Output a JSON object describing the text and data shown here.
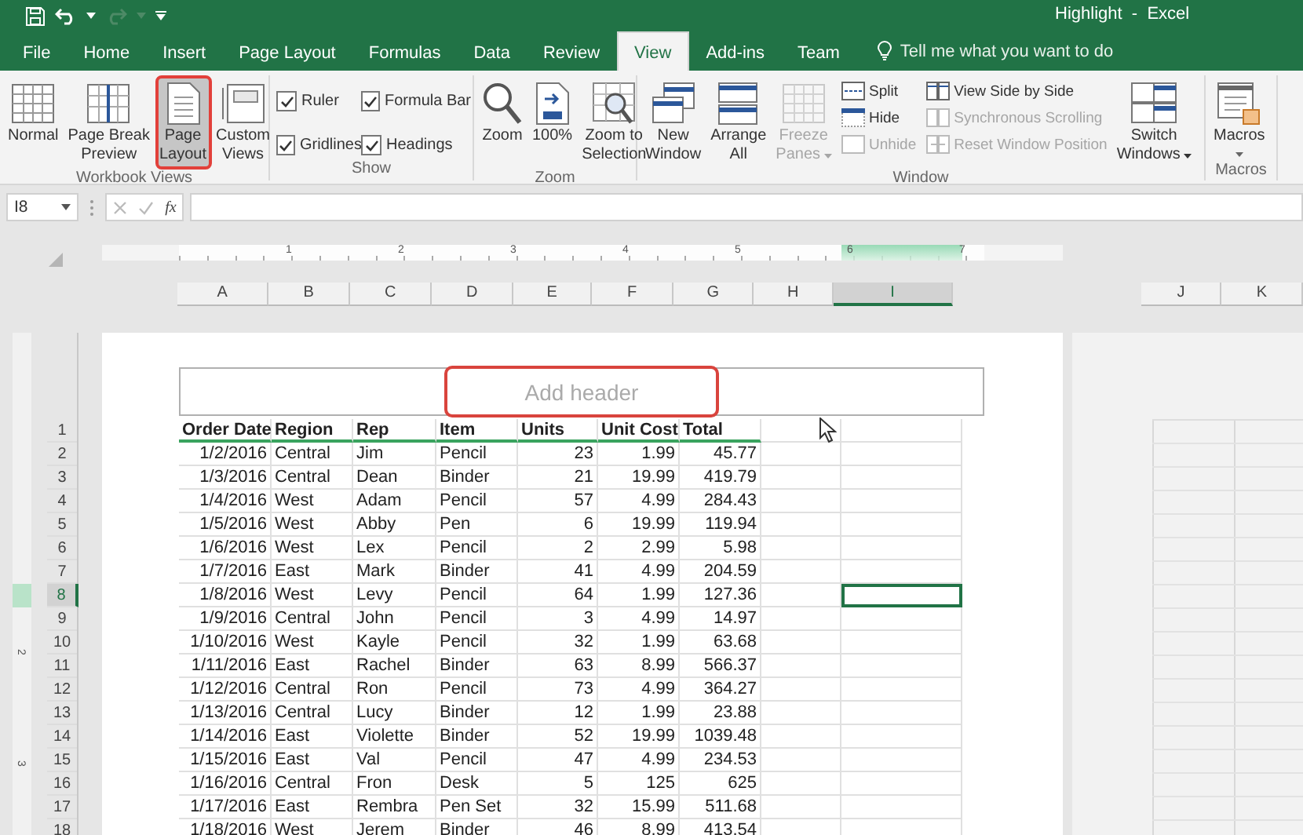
{
  "title_bar": {
    "title": "Highlight  -  Excel"
  },
  "tabs": [
    {
      "label": "File",
      "selected": false
    },
    {
      "label": "Home",
      "selected": false
    },
    {
      "label": "Insert",
      "selected": false
    },
    {
      "label": "Page Layout",
      "selected": false
    },
    {
      "label": "Formulas",
      "selected": false
    },
    {
      "label": "Data",
      "selected": false
    },
    {
      "label": "Review",
      "selected": false
    },
    {
      "label": "View",
      "selected": true
    },
    {
      "label": "Add-ins",
      "selected": false
    },
    {
      "label": "Team",
      "selected": false
    }
  ],
  "tell_me": {
    "placeholder": "Tell me what you want to do"
  },
  "ribbon": {
    "groups": [
      {
        "label": "Workbook Views",
        "items": [
          {
            "kind": "large",
            "lines": [
              "Normal"
            ],
            "selected": false
          },
          {
            "kind": "large",
            "lines": [
              "Page Break",
              "Preview"
            ],
            "selected": false
          },
          {
            "kind": "large",
            "lines": [
              "Page",
              "Layout"
            ],
            "selected": true
          },
          {
            "kind": "large",
            "lines": [
              "Custom",
              "Views"
            ],
            "selected": false
          }
        ]
      },
      {
        "label": "Show",
        "items": [
          {
            "kind": "check",
            "label": "Ruler",
            "checked": true
          },
          {
            "kind": "check",
            "label": "Formula Bar",
            "checked": true
          },
          {
            "kind": "check",
            "label": "Gridlines",
            "checked": true
          },
          {
            "kind": "check",
            "label": "Headings",
            "checked": true
          }
        ]
      },
      {
        "label": "Zoom",
        "items": [
          {
            "kind": "large",
            "lines": [
              "Zoom"
            ]
          },
          {
            "kind": "large",
            "lines": [
              "100%"
            ]
          },
          {
            "kind": "large",
            "lines": [
              "Zoom to",
              "Selection"
            ]
          }
        ]
      },
      {
        "label": "Window",
        "items": [
          {
            "kind": "large",
            "lines": [
              "New",
              "Window"
            ],
            "disabled": false
          },
          {
            "kind": "large",
            "lines": [
              "Arrange",
              "All"
            ],
            "disabled": false
          },
          {
            "kind": "large",
            "lines": [
              "Freeze",
              "Panes"
            ],
            "disabled": true,
            "dropdown": true
          },
          {
            "kind": "stack",
            "items": [
              {
                "label": "Split",
                "disabled": false
              },
              {
                "label": "Hide",
                "disabled": false
              },
              {
                "label": "Unhide",
                "disabled": true
              }
            ]
          },
          {
            "kind": "stack",
            "items": [
              {
                "label": "View Side by Side",
                "disabled": false
              },
              {
                "label": "Synchronous Scrolling",
                "disabled": true
              },
              {
                "label": "Reset Window Position",
                "disabled": true
              }
            ]
          },
          {
            "kind": "large",
            "lines": [
              "Switch",
              "Windows"
            ],
            "disabled": false,
            "dropdown": true
          }
        ]
      },
      {
        "label": "Macros",
        "items": [
          {
            "kind": "large",
            "lines": [
              "Macros"
            ],
            "dropdown": true
          }
        ]
      }
    ]
  },
  "formula_bar": {
    "name_box": "I8",
    "function_label": "fx"
  },
  "ruler": {
    "marks": [
      "1",
      "2",
      "3",
      "4",
      "5",
      "6",
      "7"
    ]
  },
  "vertical_ruler": {
    "marks": [
      "2",
      "3"
    ]
  },
  "header": {
    "placeholder": "Add header",
    "highlighted": true
  },
  "sheet": {
    "columns": [
      {
        "letter": "A",
        "selected": false
      },
      {
        "letter": "B",
        "selected": false
      },
      {
        "letter": "C",
        "selected": false
      },
      {
        "letter": "D",
        "selected": false
      },
      {
        "letter": "E",
        "selected": false
      },
      {
        "letter": "F",
        "selected": false
      },
      {
        "letter": "G",
        "selected": false
      },
      {
        "letter": "H",
        "selected": false
      },
      {
        "letter": "I",
        "selected": true
      }
    ],
    "next_page_columns": [
      "J",
      "K"
    ],
    "header_row": {
      "number": "1",
      "cells": [
        "Order Date",
        "Region",
        "Rep",
        "Item",
        "Units",
        "Unit Cost",
        "Total"
      ]
    },
    "rows": [
      {
        "number": "2",
        "selected": false,
        "cells": [
          "1/2/2016",
          "Central",
          "Jim",
          "Pencil",
          "23",
          "1.99",
          "45.77"
        ]
      },
      {
        "number": "3",
        "selected": false,
        "cells": [
          "1/3/2016",
          "Central",
          "Dean",
          "Binder",
          "21",
          "19.99",
          "419.79"
        ]
      },
      {
        "number": "4",
        "selected": false,
        "cells": [
          "1/4/2016",
          "West",
          "Adam",
          "Pencil",
          "57",
          "4.99",
          "284.43"
        ]
      },
      {
        "number": "5",
        "selected": false,
        "cells": [
          "1/5/2016",
          "West",
          "Abby",
          "Pen",
          "6",
          "19.99",
          "119.94"
        ]
      },
      {
        "number": "6",
        "selected": false,
        "cells": [
          "1/6/2016",
          "West",
          "Lex",
          "Pencil",
          "2",
          "2.99",
          "5.98"
        ]
      },
      {
        "number": "7",
        "selected": false,
        "cells": [
          "1/7/2016",
          "East",
          "Mark",
          "Binder",
          "41",
          "4.99",
          "204.59"
        ]
      },
      {
        "number": "8",
        "selected": true,
        "cells": [
          "1/8/2016",
          "West",
          "Levy",
          "Pencil",
          "64",
          "1.99",
          "127.36"
        ]
      },
      {
        "number": "9",
        "selected": false,
        "cells": [
          "1/9/2016",
          "Central",
          "John",
          "Pencil",
          "3",
          "4.99",
          "14.97"
        ]
      },
      {
        "number": "10",
        "selected": false,
        "cells": [
          "1/10/2016",
          "West",
          "Kayle",
          "Pencil",
          "32",
          "1.99",
          "63.68"
        ]
      },
      {
        "number": "11",
        "selected": false,
        "cells": [
          "1/11/2016",
          "East",
          "Rachel",
          "Binder",
          "63",
          "8.99",
          "566.37"
        ]
      },
      {
        "number": "12",
        "selected": false,
        "cells": [
          "1/12/2016",
          "Central",
          "Ron",
          "Pencil",
          "73",
          "4.99",
          "364.27"
        ]
      },
      {
        "number": "13",
        "selected": false,
        "cells": [
          "1/13/2016",
          "Central",
          "Lucy",
          "Binder",
          "12",
          "1.99",
          "23.88"
        ]
      },
      {
        "number": "14",
        "selected": false,
        "cells": [
          "1/14/2016",
          "East",
          "Violette",
          "Binder",
          "52",
          "19.99",
          "1039.48"
        ]
      },
      {
        "number": "15",
        "selected": false,
        "cells": [
          "1/15/2016",
          "East",
          "Val",
          "Pencil",
          "47",
          "4.99",
          "234.53"
        ]
      },
      {
        "number": "16",
        "selected": false,
        "cells": [
          "1/16/2016",
          "Central",
          "Fron",
          "Desk",
          "5",
          "125",
          "625"
        ]
      },
      {
        "number": "17",
        "selected": false,
        "cells": [
          "1/17/2016",
          "East",
          "Rembra",
          "Pen Set",
          "32",
          "15.99",
          "511.68"
        ]
      },
      {
        "number": "18",
        "selected": false,
        "cells": [
          "1/18/2016",
          "West",
          "Jerem",
          "Binder",
          "46",
          "8.99",
          "413.54"
        ]
      }
    ]
  }
}
